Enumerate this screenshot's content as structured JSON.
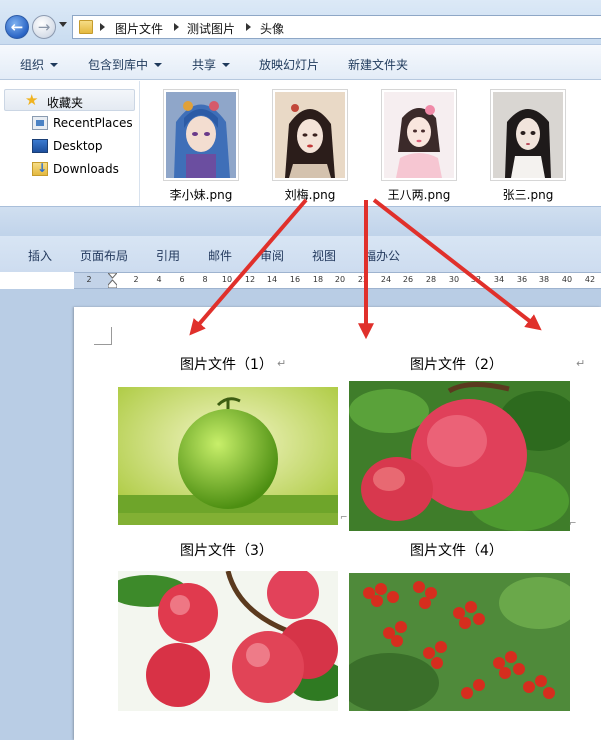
{
  "explorer": {
    "breadcrumbs": [
      "图片文件",
      "测试图片",
      "头像"
    ],
    "commands": [
      {
        "label": "组织",
        "dropdown": true
      },
      {
        "label": "包含到库中",
        "dropdown": true
      },
      {
        "label": "共享",
        "dropdown": true
      },
      {
        "label": "放映幻灯片",
        "dropdown": false
      },
      {
        "label": "新建文件夹",
        "dropdown": false
      }
    ],
    "nav_pane": {
      "favorites": "收藏夹",
      "items": [
        {
          "label": "RecentPlaces",
          "icon": "recent-places-icon"
        },
        {
          "label": "Desktop",
          "icon": "desktop-icon"
        },
        {
          "label": "Downloads",
          "icon": "downloads-folder-icon"
        }
      ]
    },
    "files": [
      {
        "name": "李小妹.png"
      },
      {
        "name": "刘梅.png"
      },
      {
        "name": "王八两.png"
      },
      {
        "name": "张三.png"
      }
    ]
  },
  "word": {
    "ribbon_tabs": [
      "插入",
      "页面布局",
      "引用",
      "邮件",
      "审阅",
      "视图",
      "福办公"
    ],
    "ruler_numbers": [
      "2",
      "2",
      "4",
      "6",
      "8",
      "10",
      "12",
      "14",
      "16",
      "18",
      "20",
      "22",
      "24",
      "26",
      "28",
      "30",
      "32",
      "34",
      "36",
      "38",
      "40",
      "42"
    ],
    "captions": [
      "图片文件（1）",
      "图片文件（2）",
      "图片文件（3）",
      "图片文件（4）"
    ],
    "para_mark": "↵",
    "photos": [
      {
        "subject": "green melon"
      },
      {
        "subject": "peaches"
      },
      {
        "subject": "red apples"
      },
      {
        "subject": "red berries"
      }
    ]
  },
  "colors": {
    "annotation_arrow": "#e0302b",
    "page_background": "#b9cde5",
    "accent": "#1e395b"
  }
}
